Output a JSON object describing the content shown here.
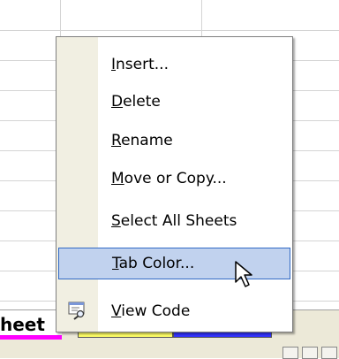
{
  "context_menu": {
    "items": [
      {
        "pre": "",
        "key": "I",
        "post": "nsert..."
      },
      {
        "pre": "",
        "key": "D",
        "post": "elete"
      },
      {
        "pre": "",
        "key": "R",
        "post": "ename"
      },
      {
        "pre": "",
        "key": "M",
        "post": "ove or Copy..."
      },
      {
        "pre": "",
        "key": "S",
        "post": "elect All Sheets"
      },
      {
        "pre": "",
        "key": "T",
        "post": "ab Color..."
      },
      {
        "pre": "",
        "key": "V",
        "post": "iew Code"
      }
    ],
    "highlighted_index": 5,
    "icons": {
      "view_code": "view-code-icon"
    }
  },
  "sheet_tabs": {
    "active_visible_text": "heet",
    "active_color": "#ff00ff",
    "other_tab_colors": [
      "#ffff66",
      "#3333ff"
    ]
  },
  "colors": {
    "menu_highlight": "#c1d2ee",
    "menu_highlight_border": "#316ac5",
    "menu_gutter": "#f1efe2"
  }
}
